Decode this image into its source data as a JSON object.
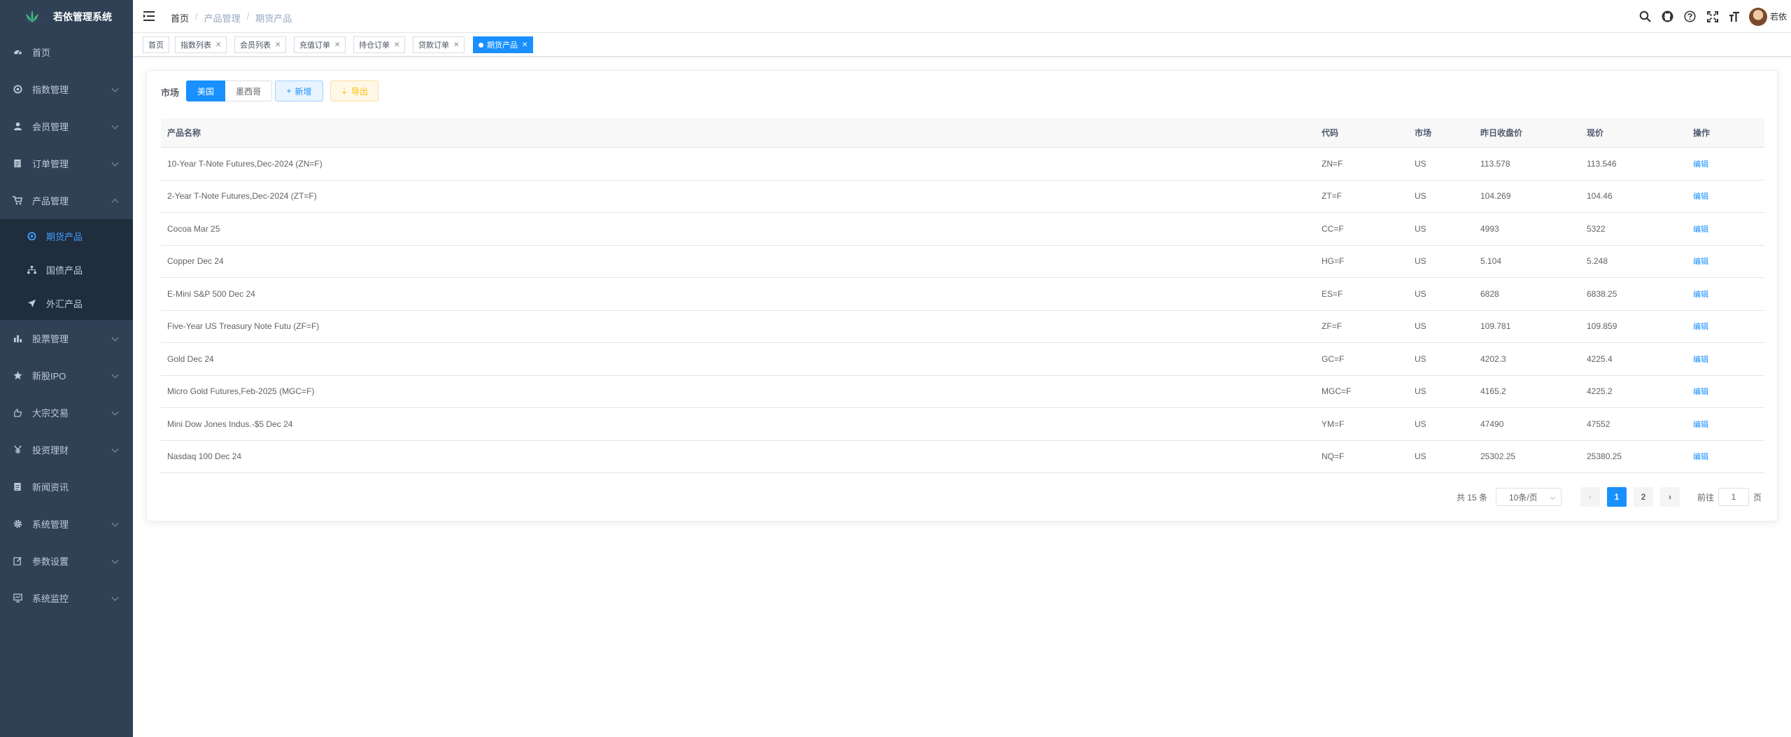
{
  "app": {
    "title": "若依管理系统"
  },
  "sidebar": {
    "items": [
      {
        "label": "首页",
        "icon": "dashboard-icon"
      },
      {
        "label": "指数管理",
        "icon": "settings-gear-icon"
      },
      {
        "label": "会员管理",
        "icon": "user-icon"
      },
      {
        "label": "订单管理",
        "icon": "document-icon"
      },
      {
        "label": "产品管理",
        "icon": "cart-icon"
      },
      {
        "label": "股票管理",
        "icon": "bar-chart-icon"
      },
      {
        "label": "新股IPO",
        "icon": "star-icon"
      },
      {
        "label": "大宗交易",
        "icon": "hand-icon"
      },
      {
        "label": "投资理财",
        "icon": "yen-icon"
      },
      {
        "label": "新闻资讯",
        "icon": "news-icon"
      },
      {
        "label": "系统管理",
        "icon": "gear-icon"
      },
      {
        "label": "参数设置",
        "icon": "edit-icon"
      },
      {
        "label": "系统监控",
        "icon": "monitor-icon"
      }
    ],
    "submenu": [
      {
        "label": "期货产品",
        "icon": "futures-icon",
        "active": true
      },
      {
        "label": "国债产品",
        "icon": "tree-icon",
        "active": false
      },
      {
        "label": "外汇产品",
        "icon": "send-icon",
        "active": false
      }
    ]
  },
  "breadcrumb": {
    "home": "首页",
    "items": [
      "产品管理",
      "期货产品"
    ]
  },
  "user": {
    "name": "若依"
  },
  "tags": [
    {
      "label": "首页"
    },
    {
      "label": "指数列表"
    },
    {
      "label": "会员列表"
    },
    {
      "label": "充值订单"
    },
    {
      "label": "持仓订单"
    },
    {
      "label": "贷款订单"
    },
    {
      "label": "期货产品"
    }
  ],
  "filters": {
    "market_label": "市场",
    "markets": [
      "美国",
      "墨西哥"
    ],
    "selected_market": "美国",
    "add_label": "新增",
    "export_label": "导出"
  },
  "table": {
    "columns": [
      "产品名称",
      "代码",
      "市场",
      "昨日收盘价",
      "现价",
      "操作"
    ],
    "edit_label": "编辑",
    "rows": [
      {
        "name": "10-Year T-Note Futures,Dec-2024 (ZN=F)",
        "code": "ZN=F",
        "market": "US",
        "prev_close": "113.578",
        "price": "113.546"
      },
      {
        "name": "2-Year T-Note Futures,Dec-2024 (ZT=F)",
        "code": "ZT=F",
        "market": "US",
        "prev_close": "104.269",
        "price": "104.46"
      },
      {
        "name": "Cocoa Mar 25",
        "code": "CC=F",
        "market": "US",
        "prev_close": "4993",
        "price": "5322"
      },
      {
        "name": "Copper Dec 24",
        "code": "HG=F",
        "market": "US",
        "prev_close": "5.104",
        "price": "5.248"
      },
      {
        "name": "E-Mini S&P 500 Dec 24",
        "code": "ES=F",
        "market": "US",
        "prev_close": "6828",
        "price": "6838.25"
      },
      {
        "name": "Five-Year US Treasury Note Futu (ZF=F)",
        "code": "ZF=F",
        "market": "US",
        "prev_close": "109.781",
        "price": "109.859"
      },
      {
        "name": "Gold Dec 24",
        "code": "GC=F",
        "market": "US",
        "prev_close": "4202.3",
        "price": "4225.4"
      },
      {
        "name": "Micro Gold Futures,Feb-2025 (MGC=F)",
        "code": "MGC=F",
        "market": "US",
        "prev_close": "4165.2",
        "price": "4225.2"
      },
      {
        "name": "Mini Dow Jones Indus.-$5 Dec 24",
        "code": "YM=F",
        "market": "US",
        "prev_close": "47490",
        "price": "47552"
      },
      {
        "name": "Nasdaq 100 Dec 24",
        "code": "NQ=F",
        "market": "US",
        "prev_close": "25302.25",
        "price": "25380.25"
      }
    ]
  },
  "pagination": {
    "total_text": "共 15 条",
    "page_size": "10条/页",
    "pages": [
      "1",
      "2"
    ],
    "current": "1",
    "goto_label": "前往",
    "goto_value": "1",
    "page_suffix": "页"
  },
  "colors": {
    "sidebar_bg": "#304156",
    "submenu_bg": "#1f2d3d",
    "primary": "#1890ff",
    "warning": "#ffba00"
  }
}
